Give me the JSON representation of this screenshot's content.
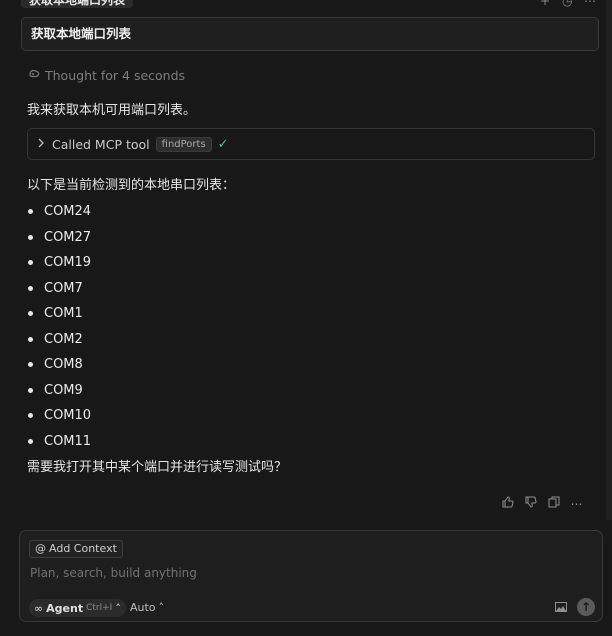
{
  "header": {
    "tab_title": "获取本地端口列表",
    "icon_1": "plus-icon",
    "icon_2": "history-icon",
    "icon_3": "more-icon"
  },
  "user_query": "获取本地端口列表",
  "thought": {
    "icon": "brain-icon",
    "label": "Thought for 4 seconds"
  },
  "assistant": {
    "intro": "我来获取本机可用端口列表。",
    "tool_call": {
      "label": "Called MCP tool",
      "tool_name": "findPorts",
      "status_icon": "check-icon"
    },
    "list_heading": "以下是当前检测到的本地串口列表：",
    "ports": [
      "COM24",
      "COM27",
      "COM19",
      "COM7",
      "COM1",
      "COM2",
      "COM8",
      "COM9",
      "COM10",
      "COM11"
    ],
    "closing": "需要我打开其中某个端口并进行读写测试吗？"
  },
  "message_actions": [
    "thumbs-up-icon",
    "thumbs-down-icon",
    "copy-icon",
    "more-icon"
  ],
  "composer": {
    "add_context_label": "Add Context",
    "placeholder": "Plan, search, build anything",
    "mode_label": "Agent",
    "mode_shortcut": "Ctrl+I",
    "model_label": "Auto"
  },
  "colors": {
    "background": "#181818",
    "panel": "#1e1e1e",
    "border": "#3a3a3a",
    "success": "#4ec27a"
  }
}
